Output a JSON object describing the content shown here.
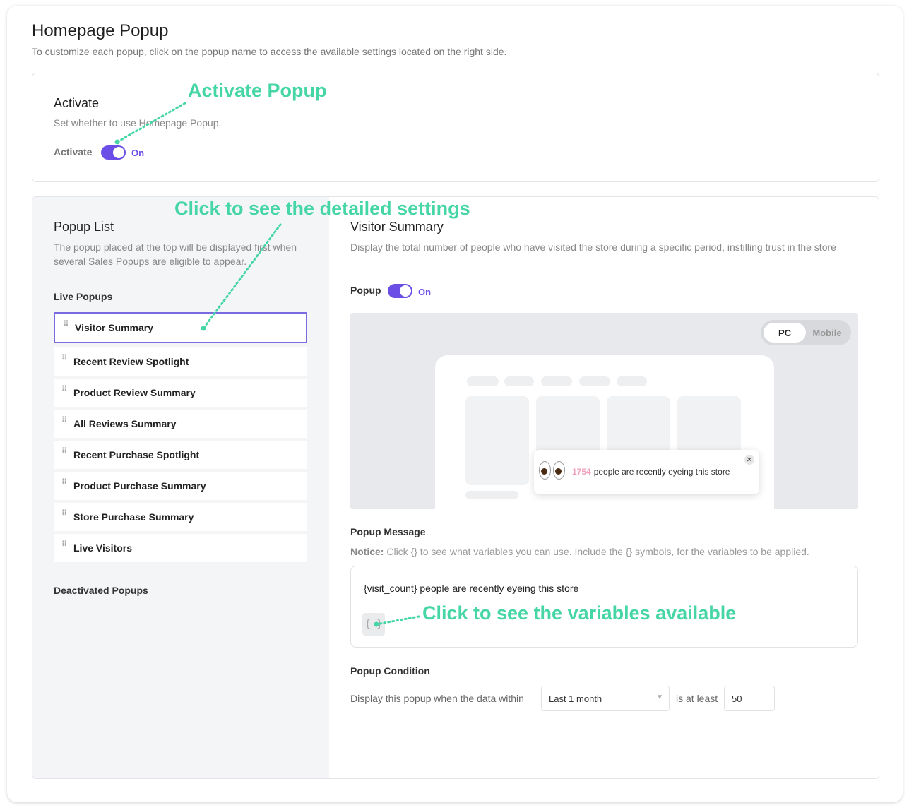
{
  "header": {
    "title": "Homepage Popup",
    "subtitle": "To customize each popup, click on the popup name to access the available settings located on the right side."
  },
  "activate": {
    "title": "Activate",
    "description": "Set whether to use Homepage Popup.",
    "label": "Activate",
    "state": "On",
    "enabled": true
  },
  "popup_list": {
    "title": "Popup List",
    "description": "The popup placed at the top will be displayed first when several Sales Popups are eligible to appear.",
    "live_heading": "Live Popups",
    "items": [
      {
        "label": "Visitor Summary",
        "selected": true
      },
      {
        "label": "Recent Review Spotlight"
      },
      {
        "label": "Product Review Summary"
      },
      {
        "label": "All Reviews Summary"
      },
      {
        "label": "Recent Purchase Spotlight"
      },
      {
        "label": "Product Purchase Summary"
      },
      {
        "label": "Store Purchase Summary"
      },
      {
        "label": "Live Visitors"
      }
    ],
    "deactivated_heading": "Deactivated Popups"
  },
  "detail": {
    "title": "Visitor Summary",
    "description": "Display the total number of people who have visited the store during a specific period, instilling trust in the store",
    "popup_label": "Popup",
    "popup_state": "On",
    "popup_enabled": true,
    "preview": {
      "device_options": [
        "PC",
        "Mobile"
      ],
      "selected_device": "PC",
      "count": "1754",
      "text": "people are recently eyeing this store",
      "icon": "eyes-emoji",
      "close_icon": "close-icon"
    },
    "message_label": "Popup Message",
    "notice_label": "Notice:",
    "notice_text": "Click {} to see what variables you can use. Include the {} symbols, for the variables to be applied.",
    "message_value": "{visit_count} people are recently eyeing this store",
    "variables_button": "{ }",
    "condition_label": "Popup Condition",
    "condition_prefix": "Display this popup when the data within",
    "condition_period": "Last 1 month",
    "condition_middle": "is at least",
    "condition_value": "50"
  },
  "annotations": {
    "activate": "Activate Popup",
    "settings": "Click to see the detailed settings",
    "variables": "Click to see the variables available"
  },
  "colors": {
    "accent": "#6b4ee6",
    "annotation": "#46d6a5",
    "count_highlight": "#f2a0b8"
  }
}
